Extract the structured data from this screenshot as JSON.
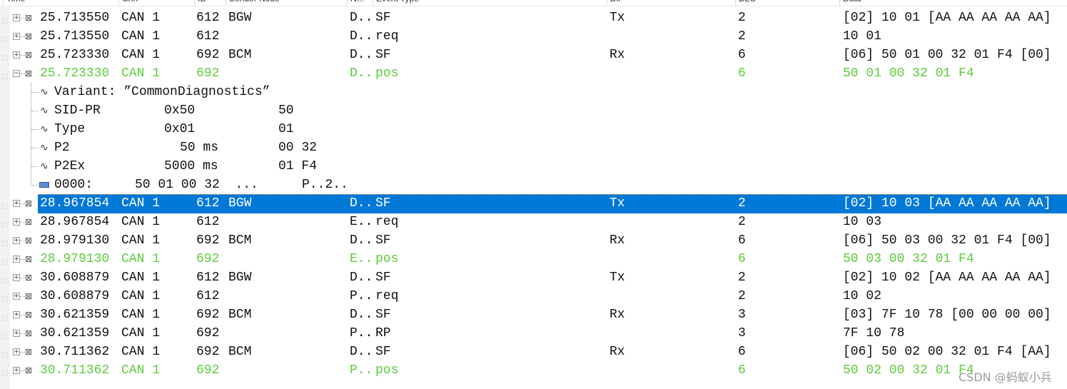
{
  "columns": [
    "Time",
    "Chn",
    "ID",
    "Sender Node",
    "N...",
    "Event Type",
    "Dir",
    "DLC",
    "Data"
  ],
  "rows": [
    {
      "time": "25.713550",
      "chn": "CAN 1",
      "id": "612",
      "sender": "BGW",
      "n": "D..",
      "event": "SF",
      "dir": "Tx",
      "dlc": "2",
      "data": "[02] 10 01 [AA AA AA AA AA]",
      "expanded": false
    },
    {
      "time": "25.713550",
      "chn": "CAN 1",
      "id": "612",
      "sender": "",
      "n": "D..",
      "event": "req",
      "dir": "",
      "dlc": "2",
      "data": "10 01",
      "expanded": false
    },
    {
      "time": "25.723330",
      "chn": "CAN 1",
      "id": "692",
      "sender": "BCM",
      "n": "D..",
      "event": "SF",
      "dir": "Rx",
      "dlc": "6",
      "data": "[06] 50 01 00 32 01 F4 [00]",
      "expanded": false
    },
    {
      "time": "25.723330",
      "chn": "CAN 1",
      "id": "692",
      "sender": "",
      "n": "D..",
      "event": "pos",
      "dir": "",
      "dlc": "6",
      "data": "50 01 00 32 01 F4",
      "expanded": true,
      "green": true
    },
    {
      "time": "28.967854",
      "chn": "CAN 1",
      "id": "612",
      "sender": "BGW",
      "n": "D..",
      "event": "SF",
      "dir": "Tx",
      "dlc": "2",
      "data": "[02] 10 03 [AA AA AA AA AA]",
      "expanded": false,
      "selected": true
    },
    {
      "time": "28.967854",
      "chn": "CAN 1",
      "id": "612",
      "sender": "",
      "n": "E..",
      "event": "req",
      "dir": "",
      "dlc": "2",
      "data": "10 03",
      "expanded": false
    },
    {
      "time": "28.979130",
      "chn": "CAN 1",
      "id": "692",
      "sender": "BCM",
      "n": "D..",
      "event": "SF",
      "dir": "Rx",
      "dlc": "6",
      "data": "[06] 50 03 00 32 01 F4 [00]",
      "expanded": false
    },
    {
      "time": "28.979130",
      "chn": "CAN 1",
      "id": "692",
      "sender": "",
      "n": "E..",
      "event": "pos",
      "dir": "",
      "dlc": "6",
      "data": "50 03 00 32 01 F4",
      "expanded": false,
      "green": true
    },
    {
      "time": "30.608879",
      "chn": "CAN 1",
      "id": "612",
      "sender": "BGW",
      "n": "D..",
      "event": "SF",
      "dir": "Tx",
      "dlc": "2",
      "data": "[02] 10 02 [AA AA AA AA AA]",
      "expanded": false
    },
    {
      "time": "30.608879",
      "chn": "CAN 1",
      "id": "612",
      "sender": "",
      "n": "P..",
      "event": "req",
      "dir": "",
      "dlc": "2",
      "data": "10 02",
      "expanded": false
    },
    {
      "time": "30.621359",
      "chn": "CAN 1",
      "id": "692",
      "sender": "BCM",
      "n": "D..",
      "event": "SF",
      "dir": "Rx",
      "dlc": "3",
      "data": "[03] 7F 10 78 [00 00 00 00]",
      "expanded": false
    },
    {
      "time": "30.621359",
      "chn": "CAN 1",
      "id": "692",
      "sender": "",
      "n": "P..",
      "event": "RP",
      "dir": "",
      "dlc": "3",
      "data": "7F 10 78",
      "expanded": false
    },
    {
      "time": "30.711362",
      "chn": "CAN 1",
      "id": "692",
      "sender": "BCM",
      "n": "D..",
      "event": "SF",
      "dir": "Rx",
      "dlc": "6",
      "data": "[06] 50 02 00 32 01 F4 [AA]",
      "expanded": false
    },
    {
      "time": "30.711362",
      "chn": "CAN 1",
      "id": "692",
      "sender": "",
      "n": "P..",
      "event": "pos",
      "dir": "",
      "dlc": "6",
      "data": "50 02 00 32 01 F4",
      "expanded": false,
      "green": true
    }
  ],
  "detail": {
    "variant": "Variant: ”CommonDiagnostics”",
    "signals": [
      {
        "name": "SID-PR",
        "value": "0x50",
        "raw": "50"
      },
      {
        "name": "Type",
        "value": "0x01",
        "raw": "01"
      },
      {
        "name": "P2",
        "value": "50 ms",
        "raw": "00 32"
      },
      {
        "name": "P2Ex",
        "value": "5000 ms",
        "raw": "01 F4"
      }
    ],
    "raw_line": {
      "offset": "0000:",
      "bytes": "50 01 00 32  ...",
      "ascii": "P..2.."
    }
  },
  "watermark": "CSDN @蚂蚁小兵",
  "colors": {
    "selected": "#0078d7",
    "response": "#5ccc3c"
  }
}
